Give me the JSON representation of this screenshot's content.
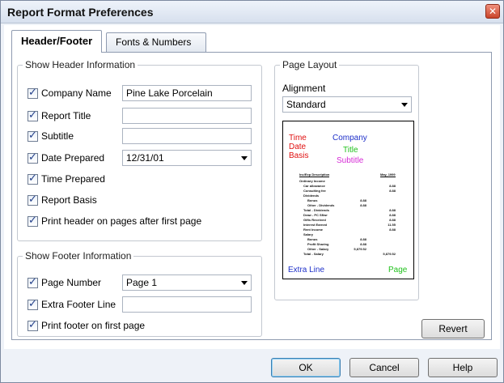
{
  "window": {
    "title": "Report Format Preferences",
    "close_glyph": "✕"
  },
  "tabs": [
    {
      "label": "Header/Footer",
      "active": true
    },
    {
      "label": "Fonts & Numbers",
      "active": false
    }
  ],
  "header_group": {
    "legend": "Show Header Information",
    "company_name": {
      "label": "Company Name",
      "checked": true,
      "value": "Pine Lake Porcelain"
    },
    "report_title": {
      "label": "Report Title",
      "checked": true,
      "value": ""
    },
    "subtitle": {
      "label": "Subtitle",
      "checked": true,
      "value": ""
    },
    "date_prepared": {
      "label": "Date Prepared",
      "checked": true,
      "value": "12/31/01"
    },
    "time_prepared": {
      "label": "Time Prepared",
      "checked": true
    },
    "report_basis": {
      "label": "Report Basis",
      "checked": true
    },
    "print_header": {
      "label": "Print header on pages after first page",
      "checked": true
    }
  },
  "footer_group": {
    "legend": "Show Footer Information",
    "page_number": {
      "label": "Page Number",
      "checked": true,
      "value": "Page 1"
    },
    "extra_footer": {
      "label": "Extra Footer Line",
      "checked": true,
      "value": ""
    },
    "print_footer": {
      "label": "Print footer on first page",
      "checked": true
    }
  },
  "page_layout": {
    "legend": "Page Layout",
    "alignment_label": "Alignment",
    "alignment_value": "Standard",
    "preview": {
      "time": "Time",
      "date": "Date",
      "basis": "Basis",
      "company": "Company",
      "title": "Title",
      "subtitle": "Subtitle",
      "extra_line": "Extra Line",
      "page": "Page",
      "table_header_left": "Inc/Exp Description",
      "table_header_right": "May, 1999",
      "lines": [
        {
          "text": "Ordinary Income",
          "indent": 0,
          "amount": ""
        },
        {
          "text": "Car allowance",
          "indent": 1,
          "amount": "8.88"
        },
        {
          "text": "Consulting fee",
          "indent": 1,
          "amount": "8.88"
        },
        {
          "text": "Dividends",
          "indent": 1,
          "amount": ""
        },
        {
          "text": "Bonus",
          "indent": 2,
          "amount": "8.88"
        },
        {
          "text": "Other - Dividends",
          "indent": 2,
          "amount": "8.88"
        },
        {
          "text": "Total - Dividends",
          "indent": 1,
          "amount": "8.88"
        },
        {
          "text": "Draw - PC Sflwr",
          "indent": 1,
          "amount": "8.88"
        },
        {
          "text": "Gifts Received",
          "indent": 1,
          "amount": "8.88"
        },
        {
          "text": "Interest Earned",
          "indent": 1,
          "amount": "11.55"
        },
        {
          "text": "Rent Income",
          "indent": 1,
          "amount": "8.88"
        },
        {
          "text": "Salary",
          "indent": 1,
          "amount": ""
        },
        {
          "text": "Bonus",
          "indent": 2,
          "amount": "8.88"
        },
        {
          "text": "Profit Sharing",
          "indent": 2,
          "amount": "8.88"
        },
        {
          "text": "Other - Salary",
          "indent": 2,
          "amount": "5,879.52"
        },
        {
          "text": "Total - Salary",
          "indent": 1,
          "amount": "5,879.52"
        }
      ]
    }
  },
  "buttons": {
    "revert": "Revert",
    "ok": "OK",
    "cancel": "Cancel",
    "help": "Help"
  }
}
